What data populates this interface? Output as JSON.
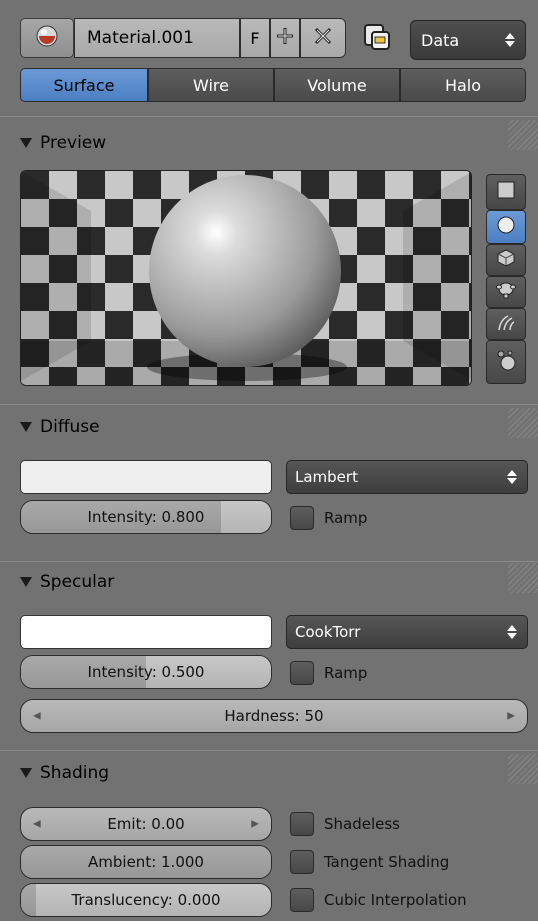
{
  "header": {
    "material_name": "Material.001",
    "fake_user_label": "F",
    "add_icon": "plus-icon",
    "remove_icon": "x-icon",
    "browse_icon": "material-sphere-icon",
    "link_icon": "copy-icon",
    "link_dropdown": "Data"
  },
  "tabs": [
    {
      "label": "Surface",
      "active": true
    },
    {
      "label": "Wire",
      "active": false
    },
    {
      "label": "Volume",
      "active": false
    },
    {
      "label": "Halo",
      "active": false
    }
  ],
  "preview": {
    "title": "Preview",
    "shapes": [
      "flat-icon",
      "sphere-icon",
      "cube-icon",
      "monkey-icon",
      "hair-icon",
      "sphere-sky-icon"
    ],
    "active_shape": "sphere-icon"
  },
  "diffuse": {
    "title": "Diffuse",
    "color": "#efefef",
    "shader": "Lambert",
    "intensity_label": "Intensity: 0.800",
    "intensity": 0.8,
    "ramp_label": "Ramp"
  },
  "specular": {
    "title": "Specular",
    "color": "#ffffff",
    "shader": "CookTorr",
    "intensity_label": "Intensity: 0.500",
    "intensity": 0.5,
    "ramp_label": "Ramp",
    "hardness_label": "Hardness: 50"
  },
  "shading": {
    "title": "Shading",
    "emit_label": "Emit: 0.00",
    "ambient_label": "Ambient: 1.000",
    "ambient": 1.0,
    "translucency_label": "Translucency: 0.000",
    "translucency": 0.0,
    "shadeless_label": "Shadeless",
    "tangent_label": "Tangent Shading",
    "cubic_label": "Cubic Interpolation"
  },
  "colors": {
    "accent": "#5b8ccf",
    "panel": "#727272"
  }
}
